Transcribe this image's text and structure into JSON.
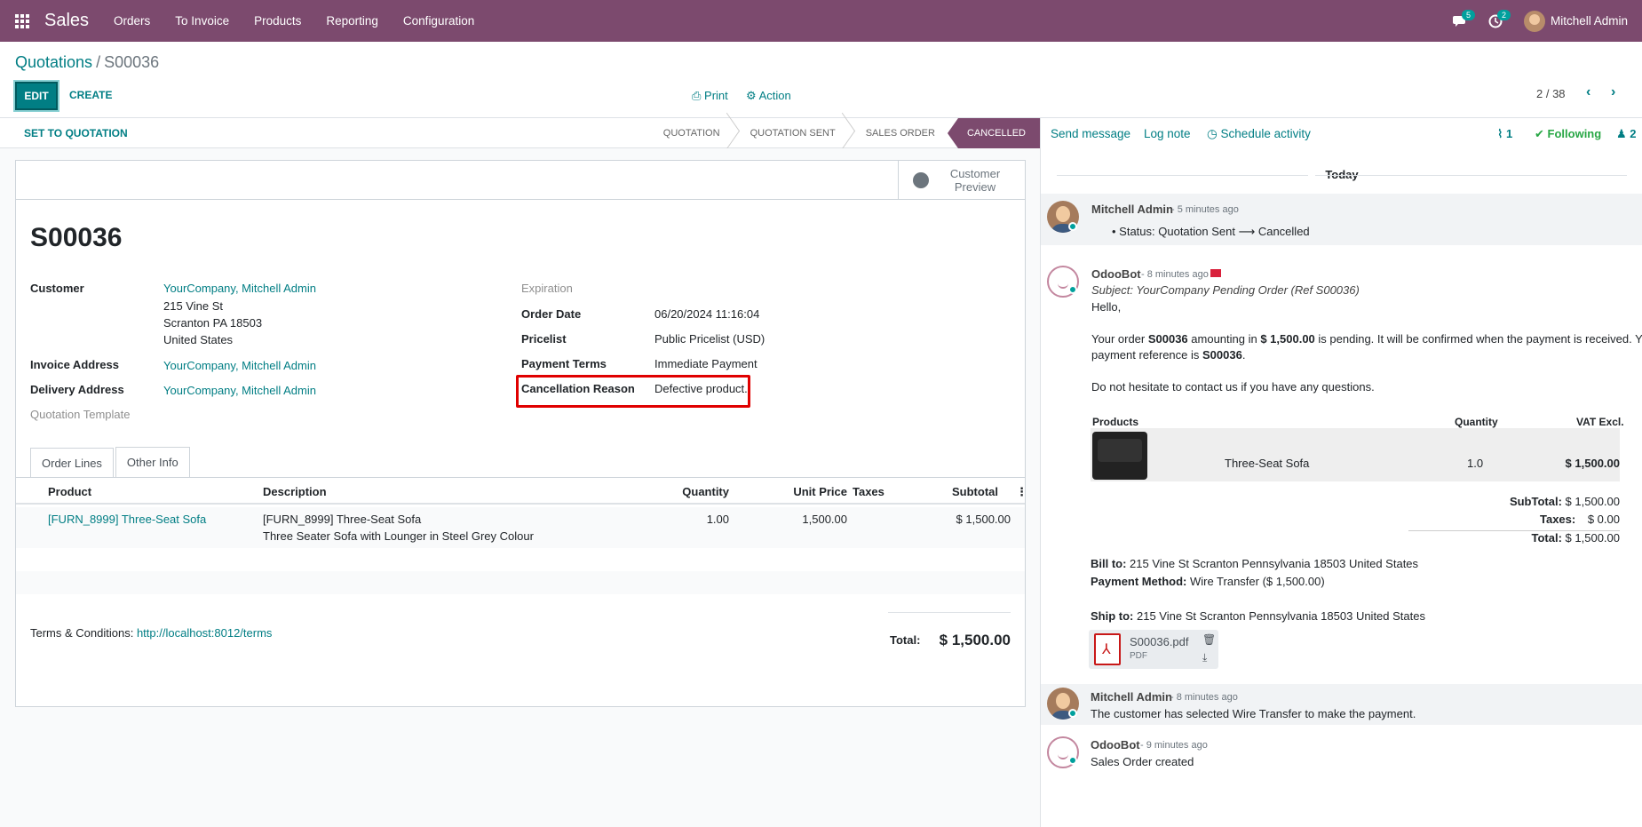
{
  "topbar": {
    "app_name": "Sales",
    "menu": [
      "Orders",
      "To Invoice",
      "Products",
      "Reporting",
      "Configuration"
    ],
    "messages_count": "5",
    "activities_count": "2",
    "user_name": "Mitchell Admin"
  },
  "control": {
    "breadcrumb_parent": "Quotations",
    "breadcrumb_sep": "/",
    "breadcrumb_current": "S00036",
    "edit_label": "EDIT",
    "create_label": "CREATE",
    "print_label": "Print",
    "action_label": "Action",
    "pager": "2 / 38"
  },
  "statusbar": {
    "set_to_quotation": "SET TO QUOTATION",
    "stages": [
      "QUOTATION",
      "QUOTATION SENT",
      "SALES ORDER",
      "CANCELLED"
    ],
    "active_stage": "CANCELLED"
  },
  "form": {
    "customer_preview": "Customer Preview",
    "order_name": "S00036",
    "customer_label": "Customer",
    "customer_value": "YourCompany, Mitchell Admin",
    "address_line1": "215 Vine St",
    "address_line2": "Scranton PA 18503",
    "address_line3": "United States",
    "invoice_address_label": "Invoice Address",
    "invoice_address_value": "YourCompany, Mitchell Admin",
    "delivery_address_label": "Delivery Address",
    "delivery_address_value": "YourCompany, Mitchell Admin",
    "quotation_template_label": "Quotation Template",
    "expiration_label": "Expiration",
    "order_date_label": "Order Date",
    "order_date_value": "06/20/2024 11:16:04",
    "pricelist_label": "Pricelist",
    "pricelist_value": "Public Pricelist (USD)",
    "payment_terms_label": "Payment Terms",
    "payment_terms_value": "Immediate Payment",
    "cancellation_reason_label": "Cancellation Reason",
    "cancellation_reason_value": "Defective product.",
    "tabs": [
      "Order Lines",
      "Other Info"
    ],
    "columns": [
      "Product",
      "Description",
      "Quantity",
      "Unit Price",
      "Taxes",
      "Subtotal"
    ],
    "lines": [
      {
        "product": "[FURN_8999] Three-Seat Sofa",
        "description_1": "[FURN_8999] Three-Seat Sofa",
        "description_2": "Three Seater Sofa with Lounger in Steel Grey Colour",
        "quantity": "1.00",
        "unit_price": "1,500.00",
        "taxes": "",
        "subtotal": "$ 1,500.00"
      }
    ],
    "terms_label": "Terms & Conditions:",
    "terms_link": "http://localhost:8012/terms",
    "total_label": "Total:",
    "total_value": "$ 1,500.00"
  },
  "chatter": {
    "send_message": "Send message",
    "log_note": "Log note",
    "schedule_activity": "Schedule activity",
    "attachments_count": "1",
    "following": "Following",
    "followers_count": "2",
    "today": "Today",
    "msg1": {
      "author": "Mitchell Admin",
      "ago": "- 5 minutes ago",
      "text": "Status: Quotation Sent ⟶ Cancelled"
    },
    "msg2": {
      "author": "OdooBot",
      "ago": "- 8 minutes ago",
      "subject": "Subject: YourCompany Pending Order (Ref S00036)",
      "hello": "Hello,",
      "body_1a": "Your order ",
      "body_1b": "S00036",
      "body_1c": " amounting in ",
      "body_1d": "$ 1,500.00",
      "body_1e": " is pending. It will be confirmed when the payment is received. Your",
      "body_2a": "payment reference is ",
      "body_2b": "S00036",
      "body_2c": ".",
      "body_3": "Do not hesitate to contact us if you have any questions.",
      "tbl_products": "Products",
      "tbl_quantity": "Quantity",
      "tbl_vat": "VAT Excl.",
      "tbl_product_name": "Three-Seat Sofa",
      "tbl_qty": "1.0",
      "tbl_price": "$ 1,500.00",
      "subtotal_label": "SubTotal:",
      "subtotal_value": "$ 1,500.00",
      "taxes_label": "Taxes:",
      "taxes_value": "$ 0.00",
      "total_label": "Total:",
      "total_value": "$ 1,500.00",
      "bill_label": "Bill to:",
      "bill_value": " 215 Vine St Scranton Pennsylvania 18503 United States",
      "payment_label": "Payment Method:",
      "payment_value": " Wire Transfer ($ 1,500.00)",
      "ship_label": "Ship to:",
      "ship_value": " 215 Vine St Scranton Pennsylvania 18503 United States",
      "attachment_name": "S00036.pdf",
      "attachment_type": "PDF"
    },
    "msg3": {
      "author": "Mitchell Admin",
      "ago": "- 8 minutes ago",
      "text": "The customer has selected Wire Transfer to make the payment."
    },
    "msg4": {
      "author": "OdooBot",
      "ago": "- 9 minutes ago",
      "text": "Sales Order created"
    }
  },
  "colors": {
    "brand": "#7c4a6e",
    "accent": "#017e84",
    "highlight_box": "#e00000"
  }
}
